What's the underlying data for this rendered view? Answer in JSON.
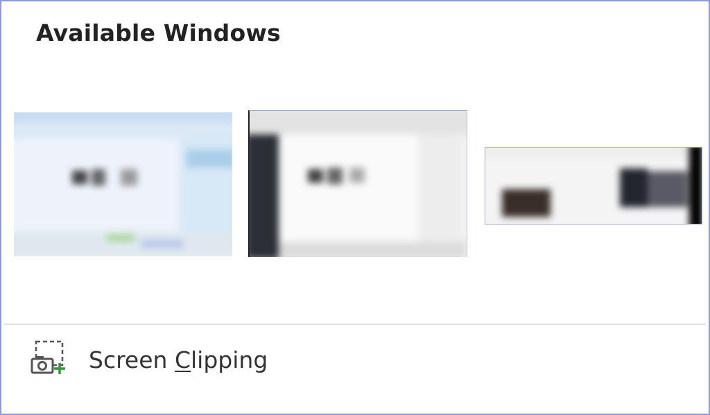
{
  "panel": {
    "heading": "Available Windows",
    "windows": [
      {
        "icon": "window-thumbnail",
        "accent": "#cfe3f5"
      },
      {
        "icon": "window-thumbnail",
        "accent": "#2b2f36"
      },
      {
        "icon": "window-thumbnail",
        "accent": "#1a1a1a"
      }
    ],
    "screen_clipping": {
      "label_prefix": "Screen ",
      "label_accesskey": "C",
      "label_suffix": "lipping",
      "icon": "camera-plus-icon",
      "accent": "#2e9b3b"
    }
  }
}
